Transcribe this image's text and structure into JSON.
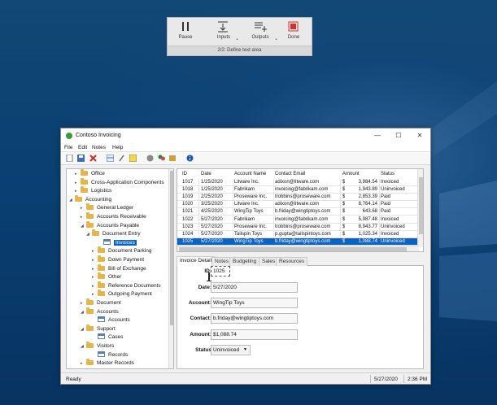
{
  "recorder": {
    "pause_label": "Pause",
    "inputs_label": "Inputs",
    "outputs_label": "Outputs",
    "done_label": "Done",
    "status_text": "2/2: Define text area"
  },
  "window": {
    "title": "Contoso Invoicing",
    "min_glyph": "—",
    "max_glyph": "☐",
    "close_glyph": "✕"
  },
  "menu": {
    "items": [
      "File",
      "Edit",
      "Notes",
      "Help"
    ]
  },
  "toolbar": {
    "icons": [
      "new-document-icon",
      "save-icon",
      "delete-icon",
      "grid-view-icon",
      "link-icon",
      "note-icon",
      "globe-icon",
      "users-icon",
      "export-icon",
      "info-icon"
    ]
  },
  "tree": {
    "items": [
      {
        "label": "Office",
        "arrow": "▸",
        "icon": "folder"
      },
      {
        "label": "Cross-Application Components",
        "arrow": "▸",
        "icon": "folder"
      },
      {
        "label": "Logistics",
        "arrow": "▸",
        "icon": "folder"
      },
      {
        "label": "Accounting",
        "arrow": "◢",
        "icon": "folder"
      },
      {
        "label": "General Ledger",
        "arrow": "▸",
        "icon": "folder"
      },
      {
        "label": "Accounts Receivable",
        "arrow": "▸",
        "icon": "folder"
      },
      {
        "label": "Accounts Payable",
        "arrow": "◢",
        "icon": "folder"
      },
      {
        "label": "Document Entry",
        "arrow": "◢",
        "icon": "folder"
      },
      {
        "label": "Invoices",
        "arrow": "",
        "icon": "file",
        "selected": true
      },
      {
        "label": "Document Parking",
        "arrow": "▸",
        "icon": "folder"
      },
      {
        "label": "Down Payment",
        "arrow": "▸",
        "icon": "folder"
      },
      {
        "label": "Bill of Exchange",
        "arrow": "▸",
        "icon": "folder"
      },
      {
        "label": "Other",
        "arrow": "▸",
        "icon": "folder"
      },
      {
        "label": "Reference Documents",
        "arrow": "▸",
        "icon": "folder"
      },
      {
        "label": "Outgoing Payment",
        "arrow": "▸",
        "icon": "folder"
      },
      {
        "label": "Document",
        "arrow": "▸",
        "icon": "folder"
      },
      {
        "label": "Accounts",
        "arrow": "◢",
        "icon": "folder"
      },
      {
        "label": "Accounts",
        "arrow": "",
        "icon": "file"
      },
      {
        "label": "Support",
        "arrow": "◢",
        "icon": "folder"
      },
      {
        "label": "Cases",
        "arrow": "",
        "icon": "file"
      },
      {
        "label": "Visitors",
        "arrow": "◢",
        "icon": "folder"
      },
      {
        "label": "Records",
        "arrow": "",
        "icon": "file"
      },
      {
        "label": "Master Records",
        "arrow": "▸",
        "icon": "folder"
      }
    ]
  },
  "grid": {
    "columns": [
      "ID",
      "Date",
      "Account Name",
      "Contact Email",
      "Amount",
      "Status"
    ],
    "currency": "$",
    "rows": [
      {
        "id": "1017",
        "date": "1/25/2020",
        "account": "Litware Inc.",
        "email": "adixon@litware.com",
        "amount": "3,984.54",
        "status": "Invoiced"
      },
      {
        "id": "1018",
        "date": "1/25/2020",
        "account": "Fabrikam",
        "email": "invoicing@fabrikam.com",
        "amount": "1,943.89",
        "status": "Uninvoiced"
      },
      {
        "id": "1019",
        "date": "2/25/2020",
        "account": "Proseware Inc.",
        "email": "trobbins@proseware.com",
        "amount": "2,853.39",
        "status": "Paid"
      },
      {
        "id": "1020",
        "date": "3/25/2020",
        "account": "Litware Inc.",
        "email": "adixon@litware.com",
        "amount": "8,764.14",
        "status": "Paid"
      },
      {
        "id": "1021",
        "date": "4/25/2020",
        "account": "WingTip Toys",
        "email": "b.friday@wingtiptoys.com",
        "amount": "643.68",
        "status": "Paid"
      },
      {
        "id": "1022",
        "date": "5/27/2020",
        "account": "Fabrikam",
        "email": "invoicing@fabrikam.com",
        "amount": "5,987.48",
        "status": "Invoiced"
      },
      {
        "id": "1023",
        "date": "5/27/2020",
        "account": "Proseware Inc.",
        "email": "trobbins@proseware.com",
        "amount": "8,943.77",
        "status": "Uninvoiced"
      },
      {
        "id": "1024",
        "date": "5/27/2020",
        "account": "Tailspin Toys",
        "email": "p.gupta@tailspintoys.com",
        "amount": "1,025.34",
        "status": "Invoiced"
      },
      {
        "id": "1025",
        "date": "5/27/2020",
        "account": "WingTip Toys",
        "email": "b.friday@wingtiptoys.com",
        "amount": "1,088.74",
        "status": "Uninvoiced",
        "selected": true
      }
    ]
  },
  "tabs": [
    "Invoice Detail",
    "Notes",
    "Budgeting",
    "Sales",
    "Resources"
  ],
  "detail": {
    "fields": [
      {
        "label": "ID:",
        "value": "1025"
      },
      {
        "label": "Date:",
        "value": "5/27/2020"
      },
      {
        "label": "Account:",
        "value": "WingTip Toys"
      },
      {
        "label": "Contact:",
        "value": "b.friday@wingtiptoys.com"
      },
      {
        "label": "Amount:",
        "value": "$1,088.74"
      },
      {
        "label": "Status",
        "value": "Uninvoiced"
      }
    ]
  },
  "statusbar": {
    "left": "Ready",
    "date": "5/27/2020",
    "time": "2:36 PM"
  },
  "colors": {
    "selection": "#0a64c8",
    "desktop": "#0c4e8c",
    "folder": "#e4b54a",
    "done_red": "#d9302c"
  }
}
